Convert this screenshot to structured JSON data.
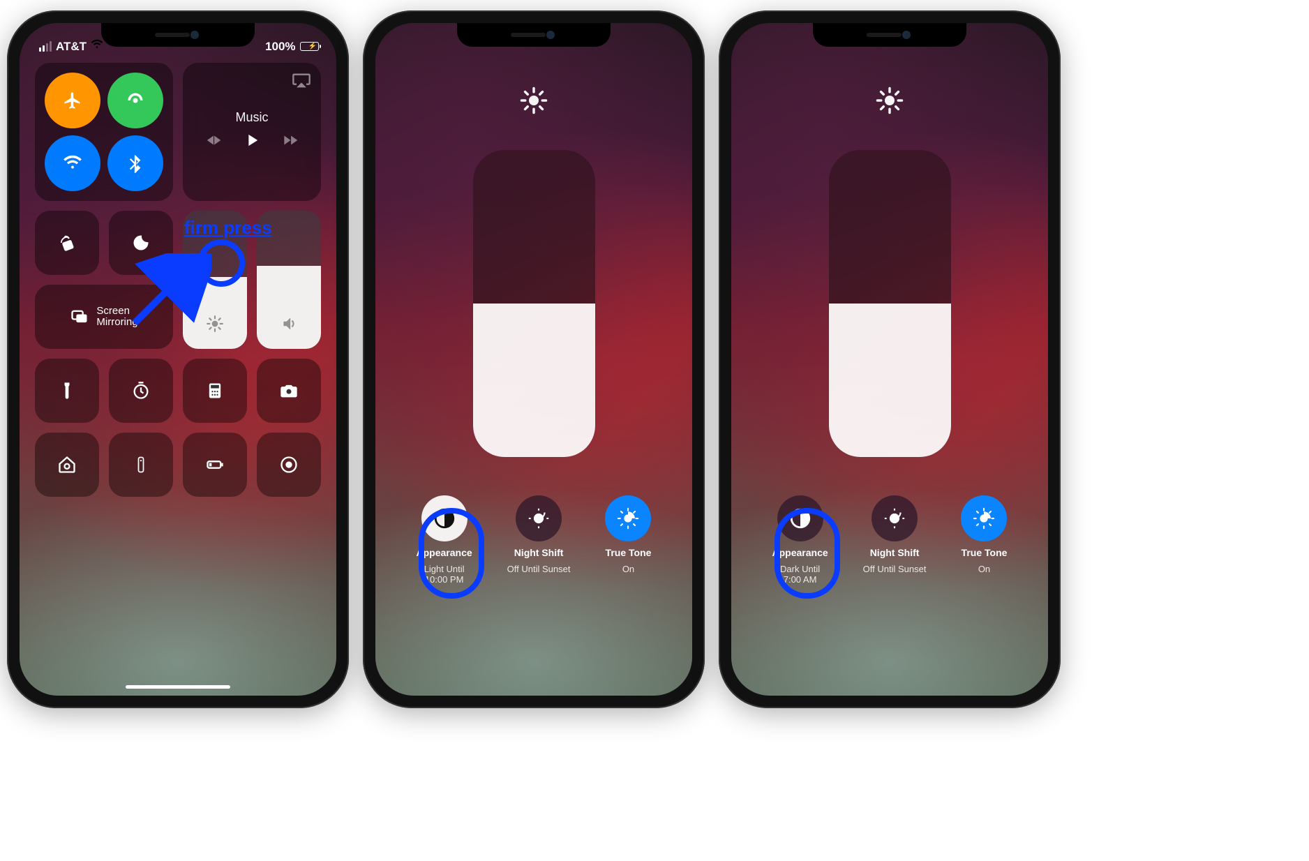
{
  "status": {
    "carrier": "AT&T",
    "battery_pct": "100%"
  },
  "cc": {
    "music_label": "Music",
    "screen_mirroring": "Screen\nMirroring",
    "toggles": {
      "airplane": "airplane-icon",
      "cellular": "cellular-icon",
      "wifi": "wifi-icon",
      "bluetooth": "bluetooth-icon"
    }
  },
  "annotation": {
    "firm_press": "firm press"
  },
  "brightness": {
    "options": [
      {
        "title": "Appearance",
        "subtitle_light": "Light Until\n10:00 PM",
        "subtitle_dark": "Dark Until\n7:00 AM"
      },
      {
        "title": "Night Shift",
        "subtitle": "Off Until Sunset"
      },
      {
        "title": "True Tone",
        "subtitle": "On"
      }
    ]
  }
}
